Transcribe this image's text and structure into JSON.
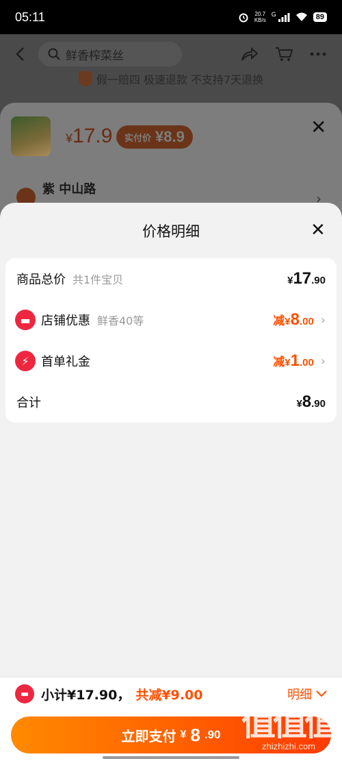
{
  "status_bar": {
    "time": "05:11",
    "net_speed_value": "20.7",
    "net_speed_unit": "KB/s",
    "network": "G",
    "battery": "89",
    "icons": [
      "alarm-icon",
      "signal-icon",
      "wifi-icon",
      "battery-icon"
    ]
  },
  "background": {
    "search_placeholder": "鲜香榨菜丝",
    "guarantee": "假一赔四 极速退款 不支持7天退换"
  },
  "sku": {
    "price_symbol": "¥",
    "price": "17.9",
    "paid_label": "实付价",
    "paid_price": "¥8.9",
    "address": "紫 中山路"
  },
  "detail": {
    "title": "价格明细",
    "rows": [
      {
        "label": "商品总价",
        "sub": "共1件宝贝",
        "prefix": "",
        "symbol": "¥",
        "int": "17",
        "dec": ".90"
      },
      {
        "label": "店铺优惠",
        "sub": "鲜香40等",
        "prefix": "减",
        "symbol": "¥",
        "int": "8",
        "dec": ".00"
      },
      {
        "label": "首单礼金",
        "sub": "",
        "prefix": "减",
        "symbol": "¥",
        "int": "1",
        "dec": ".00"
      },
      {
        "label": "合计",
        "sub": "",
        "prefix": "",
        "symbol": "¥",
        "int": "8",
        "dec": ".90"
      }
    ]
  },
  "bottom": {
    "subtotal": "小计¥17.90，",
    "reduction": "共减¥9.00",
    "detail_toggle": "明细",
    "pay_label": "立即支付",
    "pay_symbol": "¥",
    "pay_int": "8",
    "pay_dec": ".90"
  },
  "watermark": {
    "glyphs": "值值值",
    "site": "zhizhizhi.com"
  },
  "colors": {
    "accent": "#ff5000",
    "badge_red": "#ee2740",
    "pay_gradient_start": "#ff8a00",
    "pay_gradient_end": "#ff3b00"
  }
}
